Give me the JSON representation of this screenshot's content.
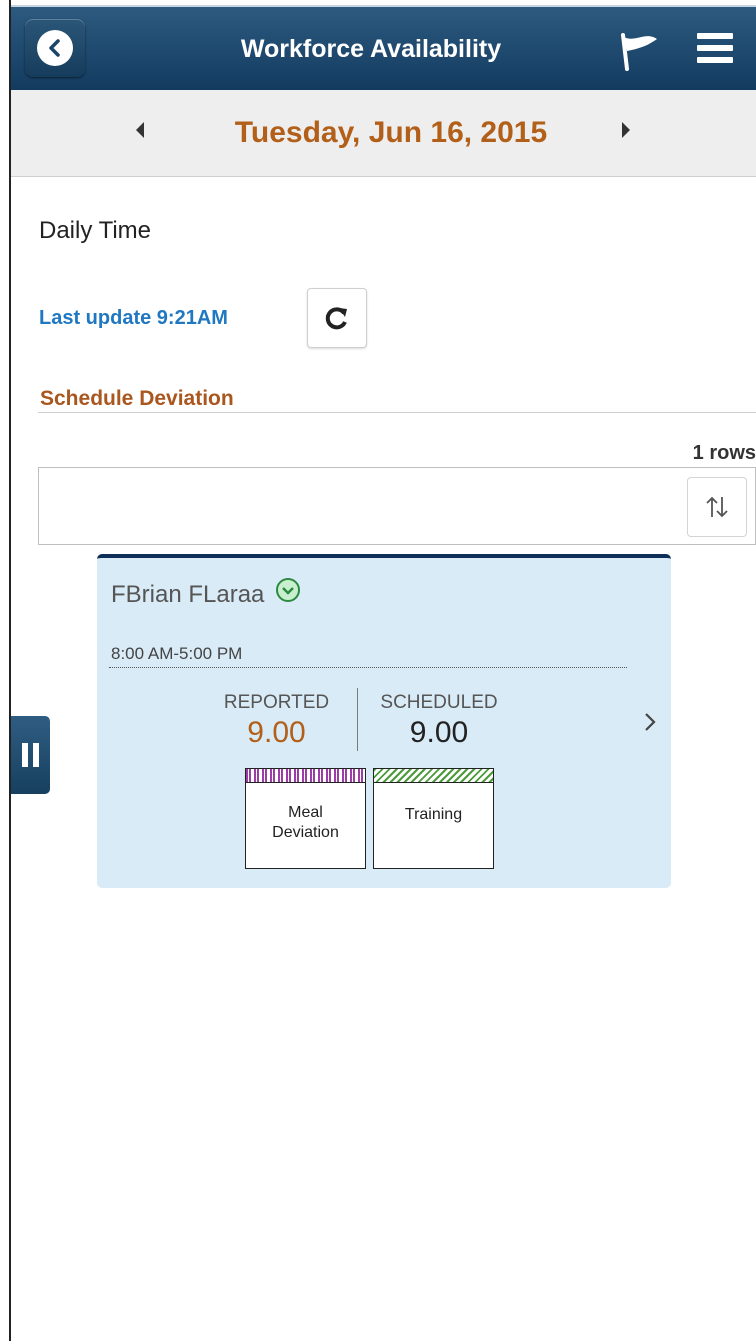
{
  "header": {
    "title": "Workforce Availability",
    "back_icon": "chevron-left-icon",
    "flag_icon": "flag-icon",
    "menu_icon": "hamburger-menu-icon",
    "background": "#1b4468"
  },
  "date_nav": {
    "date": "Tuesday, Jun 16, 2015",
    "prev_icon": "caret-left-icon",
    "next_icon": "caret-right-icon"
  },
  "page": {
    "section_title": "Daily Time",
    "last_update": "Last update 9:21AM",
    "refresh_icon": "refresh-icon"
  },
  "group": {
    "title": "Schedule Deviation",
    "row_count": "1 rows",
    "sort_icon": "sort-icon"
  },
  "card": {
    "employee": "FBrian FLaraa",
    "shift": "8:00 AM-5:00 PM",
    "reported_label": "REPORTED",
    "reported_value": "9.00",
    "scheduled_label": "SCHEDULED",
    "scheduled_value": "9.00",
    "tiles": [
      {
        "label_line1": "Meal",
        "label_line2": "Deviation",
        "color": "#9b3fa6"
      },
      {
        "label_line1": "Training",
        "label_line2": "",
        "color": "#4c9b3a"
      }
    ]
  },
  "colors": {
    "accent_orange": "#b25f1a",
    "link_blue": "#1f78c1",
    "card_bg": "#d9ebf6"
  }
}
